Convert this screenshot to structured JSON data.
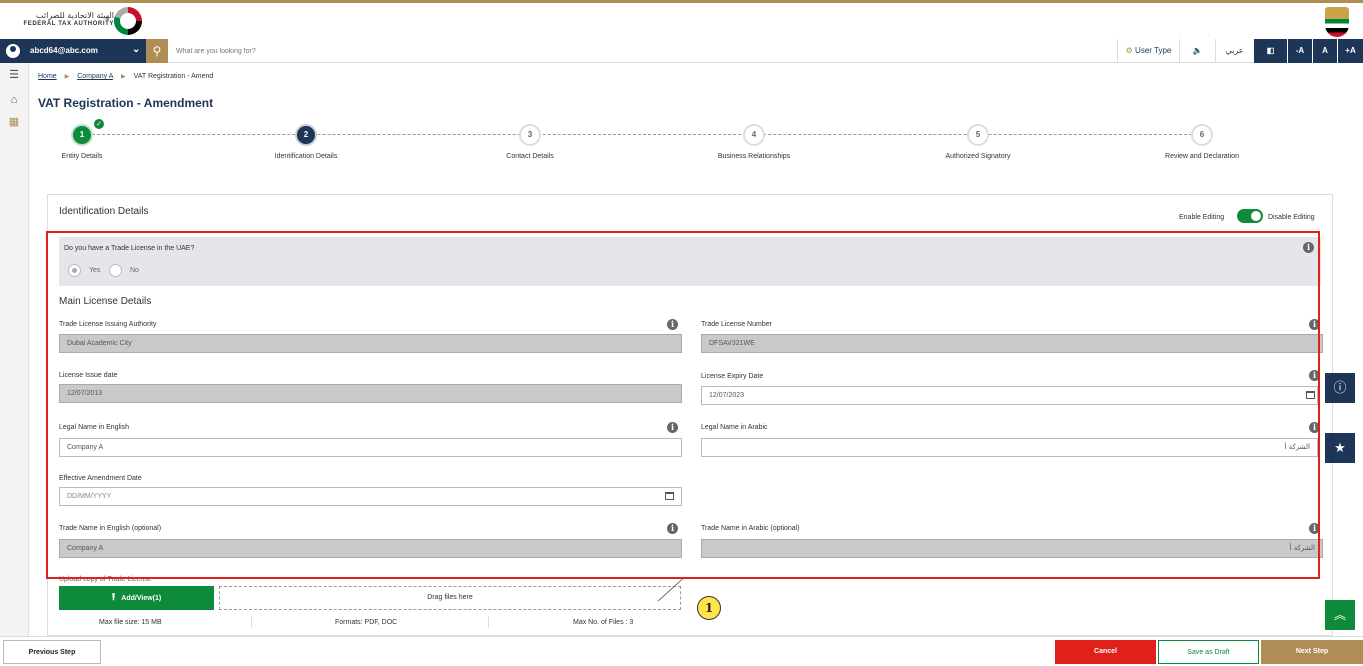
{
  "header": {
    "logo_arabic": "الهيئة الاتحادية للضرائب",
    "logo_english": "FEDERAL TAX AUTHORITY"
  },
  "navbar": {
    "user_email": "abcd64@abc.com",
    "search_placeholder": "What are you looking for?",
    "user_type_label": "User Type",
    "language_label": "عربي",
    "font_decrease": "-A",
    "font_normal": "A",
    "font_increase": "+A"
  },
  "breadcrumb": {
    "home": "Home",
    "company": "Company A",
    "current": "VAT Registration - Amend"
  },
  "page_title": "VAT Registration - Amendment",
  "steps": [
    {
      "number": "1",
      "label": "Entity Details",
      "state": "done"
    },
    {
      "number": "2",
      "label": "Identification Details",
      "state": "active"
    },
    {
      "number": "3",
      "label": "Contact Details",
      "state": "pending"
    },
    {
      "number": "4",
      "label": "Business Relationships",
      "state": "pending"
    },
    {
      "number": "5",
      "label": "Authorized Signatory",
      "state": "pending"
    },
    {
      "number": "6",
      "label": "Review and Declaration",
      "state": "pending"
    }
  ],
  "section": {
    "title": "Identification Details",
    "enable_editing": "Enable Editing",
    "disable_editing": "Disable Editing"
  },
  "trade_license_question": {
    "text": "Do you have a Trade License in the UAE?",
    "yes": "Yes",
    "no": "No",
    "selected": "Yes"
  },
  "main_license": {
    "title": "Main License Details",
    "issuing_authority_label": "Trade License Issuing Authority",
    "issuing_authority_value": "Dubai Academic City",
    "license_number_label": "Trade License Number",
    "license_number_value": "DFSAV321WE",
    "issue_date_label": "License Issue date",
    "issue_date_value": "12/07/2013",
    "expiry_date_label": "License Expiry Date",
    "expiry_date_value": "12/07/2023",
    "legal_name_en_label": "Legal Name in English",
    "legal_name_en_value": "Company A",
    "legal_name_ar_label": "Legal Name in Arabic",
    "legal_name_ar_value": "الشركة أ",
    "effective_date_label": "Effective Amendment Date",
    "effective_date_placeholder": "DD/MM/YYYY",
    "trade_name_en_label": "Trade Name in English (optional)",
    "trade_name_en_value": "Company A",
    "trade_name_ar_label": "Trade Name in Arabic (optional)",
    "trade_name_ar_value": "الشركة أ"
  },
  "upload": {
    "label": "Upload copy of Trade License",
    "button": "Add/View(1)",
    "drop_text": "Drag files here",
    "max_size": "Max file size: 15 MB",
    "formats": "Formats: PDF, DOC",
    "max_files": "Max No. of Files : 3"
  },
  "callout_number": "1",
  "footer": {
    "previous": "Previous Step",
    "cancel": "Cancel",
    "save_draft": "Save as Draft",
    "next": "Next Step"
  },
  "colors": {
    "navy": "#1d3557",
    "gold": "#b08d55",
    "green": "#0e8a3b",
    "red": "#e0201b"
  }
}
